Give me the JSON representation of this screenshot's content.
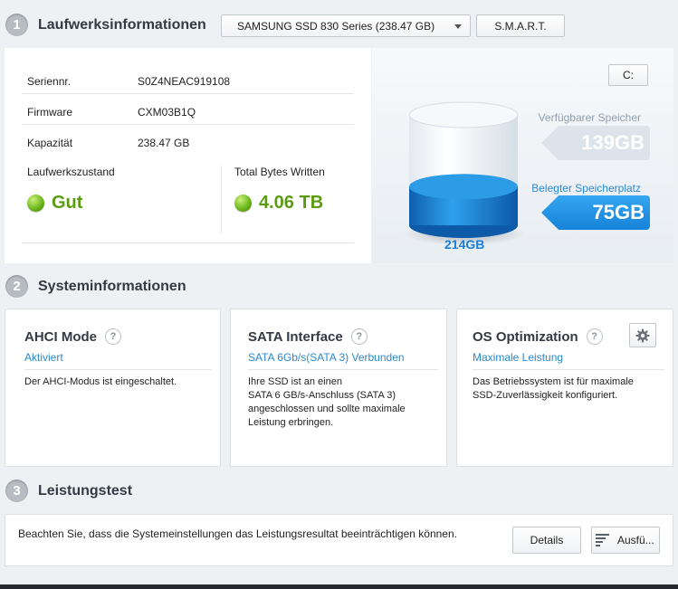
{
  "sections": {
    "drive_info": {
      "number": "1",
      "title": "Laufwerksinformationen"
    },
    "system_info": {
      "number": "2",
      "title": "Systeminformationen"
    },
    "benchmark": {
      "number": "3",
      "title": "Leistungstest"
    }
  },
  "drive_selector": {
    "value": "SAMSUNG SSD 830 Series (238.47 GB)"
  },
  "smart_button": "S.M.A.R.T.",
  "drive_letter_button": "C:",
  "info_rows": [
    {
      "label": "Seriennr.",
      "value": "S0Z4NEAC919108"
    },
    {
      "label": "Firmware",
      "value": "CXM03B1Q"
    },
    {
      "label": "Kapazität",
      "value": "238.47 GB"
    }
  ],
  "health": {
    "label": "Laufwerkszustand",
    "value": "Gut"
  },
  "tbw": {
    "label": "Total Bytes Written",
    "value": "4.06 TB"
  },
  "capacity": {
    "free_label": "Verfügbarer Speicher",
    "free_value": "139GB",
    "used_label": "Belegter Speicherplatz",
    "used_value": "75GB",
    "total": "214GB",
    "used_fraction": 0.35
  },
  "cards": [
    {
      "title": "AHCI Mode",
      "status": "Aktiviert",
      "description": "Der AHCI-Modus ist eingeschaltet."
    },
    {
      "title": "SATA Interface",
      "status": "SATA 6Gb/s(SATA 3) Verbunden",
      "description": "Ihre SSD ist an einen\nSATA 6 GB/s-Anschluss (SATA 3)\nangeschlossen und sollte maximale\nLeistung erbringen."
    },
    {
      "title": "OS Optimization",
      "status": "Maximale Leistung",
      "description": "Das Betriebssystem ist für maximale\nSSD-Zuverlässigkeit konfiguriert."
    }
  ],
  "question_mark": "?",
  "benchmark": {
    "note": "Beachten Sie, dass die Systemeinstellungen das Leistungsresultat beeinträchtigen können.",
    "details_button": "Details",
    "run_button": "Ausfü..."
  },
  "colors": {
    "accent": "#1682d9",
    "good": "#5b9b11"
  }
}
